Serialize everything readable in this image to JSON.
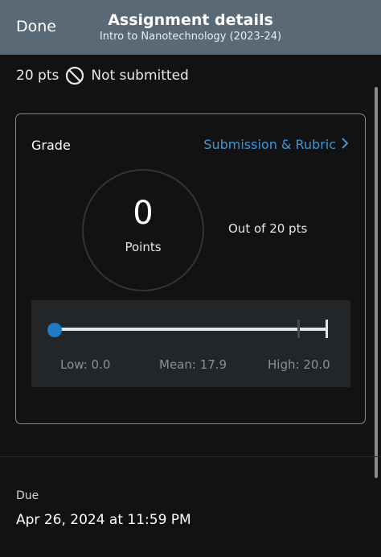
{
  "header": {
    "done_label": "Done",
    "title": "Assignment details",
    "subtitle": "Intro to Nanotechnology (2023-24)"
  },
  "status": {
    "points": "20 pts",
    "submission_status": "Not submitted",
    "icon": "not-submitted-icon"
  },
  "grade_card": {
    "heading": "Grade",
    "link_label": "Submission & Rubric",
    "link_icon": "chevron-right-icon",
    "score": "0",
    "score_label": "Points",
    "out_of": "Out of 20 pts",
    "stats": {
      "low_label": "Low: 0.0",
      "mean_label": "Mean: 17.9",
      "high_label": "High: 20.0",
      "score_value": 0,
      "low": 0.0,
      "mean": 17.9,
      "high": 20.0,
      "max": 20
    }
  },
  "due": {
    "label": "Due",
    "value": "Apr 26, 2024 at 11:59 PM"
  },
  "colors": {
    "header_bg": "#5a6976",
    "accent": "#3a98d8",
    "thumb": "#1f7bc7",
    "background": "#121212"
  }
}
